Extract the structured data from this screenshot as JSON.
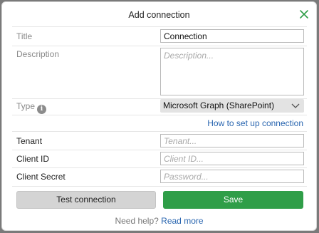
{
  "dialog": {
    "title": "Add connection",
    "close_icon": "close-icon"
  },
  "form": {
    "title_label": "Title",
    "title_value": "Connection",
    "description_label": "Description",
    "description_placeholder": "Description...",
    "type_label": "Type",
    "type_value": "Microsoft Graph (SharePoint)",
    "info_icon": "info-icon",
    "help_link": "How to set up connection",
    "tenant_label": "Tenant",
    "tenant_placeholder": "Tenant...",
    "client_id_label": "Client ID",
    "client_id_placeholder": "Client ID...",
    "client_secret_label": "Client Secret",
    "client_secret_placeholder": "Password..."
  },
  "actions": {
    "test_label": "Test connection",
    "save_label": "Save"
  },
  "footer": {
    "need_help": "Need help?",
    "read_more": "Read more"
  },
  "colors": {
    "save_button": "#2f9e48",
    "link": "#2a66b0",
    "close_icon": "#2f9e48"
  }
}
